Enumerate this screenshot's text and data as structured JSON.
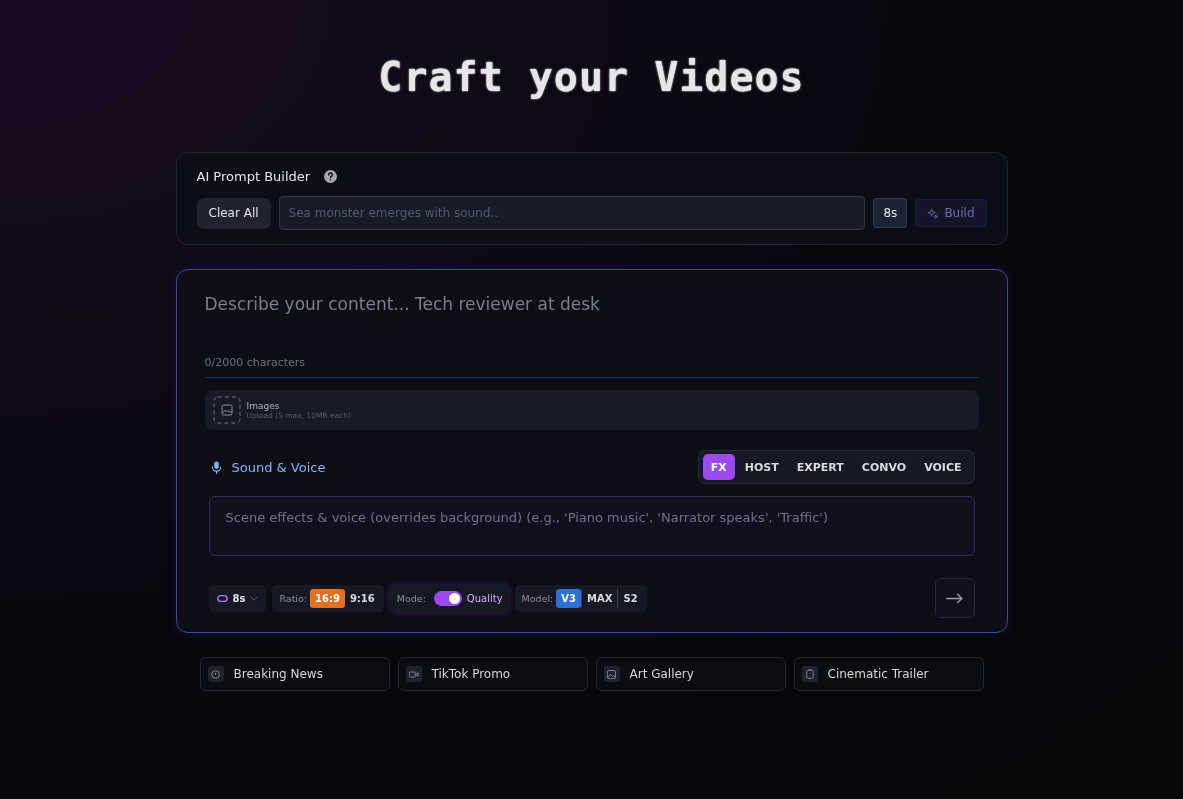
{
  "title": "Craft your Videos",
  "prompt_builder": {
    "heading": "AI Prompt Builder",
    "clear_button": "Clear All",
    "input": {
      "placeholder": "Sea monster emerges with sound.."
    },
    "duration": "8s",
    "build_button": {
      "label": "Build",
      "disabled": true
    }
  },
  "composer": {
    "description": {
      "placeholder": "Describe your content... Tech reviewer at desk"
    },
    "char_count": "0/2000 characters",
    "upload": {
      "title": "Images",
      "hint": "Upload (5 max, 10MB each)"
    },
    "sound": {
      "heading": "Sound & Voice",
      "tabs": [
        {
          "label": "FX",
          "selected": true
        },
        {
          "label": "HOST",
          "selected": false
        },
        {
          "label": "EXPERT",
          "selected": false
        },
        {
          "label": "CONVO",
          "selected": false
        },
        {
          "label": "VOICE",
          "selected": false
        }
      ],
      "input": {
        "placeholder": "Scene effects & voice (overrides background) (e.g., 'Piano music', 'Narrator speaks', 'Traffic')"
      }
    },
    "duration": "8s",
    "ratio": {
      "label": "Ratio:",
      "options": [
        {
          "label": "16:9",
          "selected": true
        },
        {
          "label": "9:16",
          "selected": false
        }
      ]
    },
    "mode": {
      "label": "Mode:",
      "on": true,
      "value": "Quality"
    },
    "model": {
      "label": "Model:",
      "options": [
        {
          "label": "V3",
          "selected": true
        },
        {
          "label": "MAX",
          "selected": false
        },
        {
          "label": "S2",
          "selected": false
        }
      ]
    }
  },
  "presets": [
    {
      "kind": "news",
      "label": "Breaking News"
    },
    {
      "kind": "video",
      "label": "TikTok Promo"
    },
    {
      "kind": "image",
      "label": "Art Gallery"
    },
    {
      "kind": "film",
      "label": "Cinematic Trailer"
    }
  ]
}
